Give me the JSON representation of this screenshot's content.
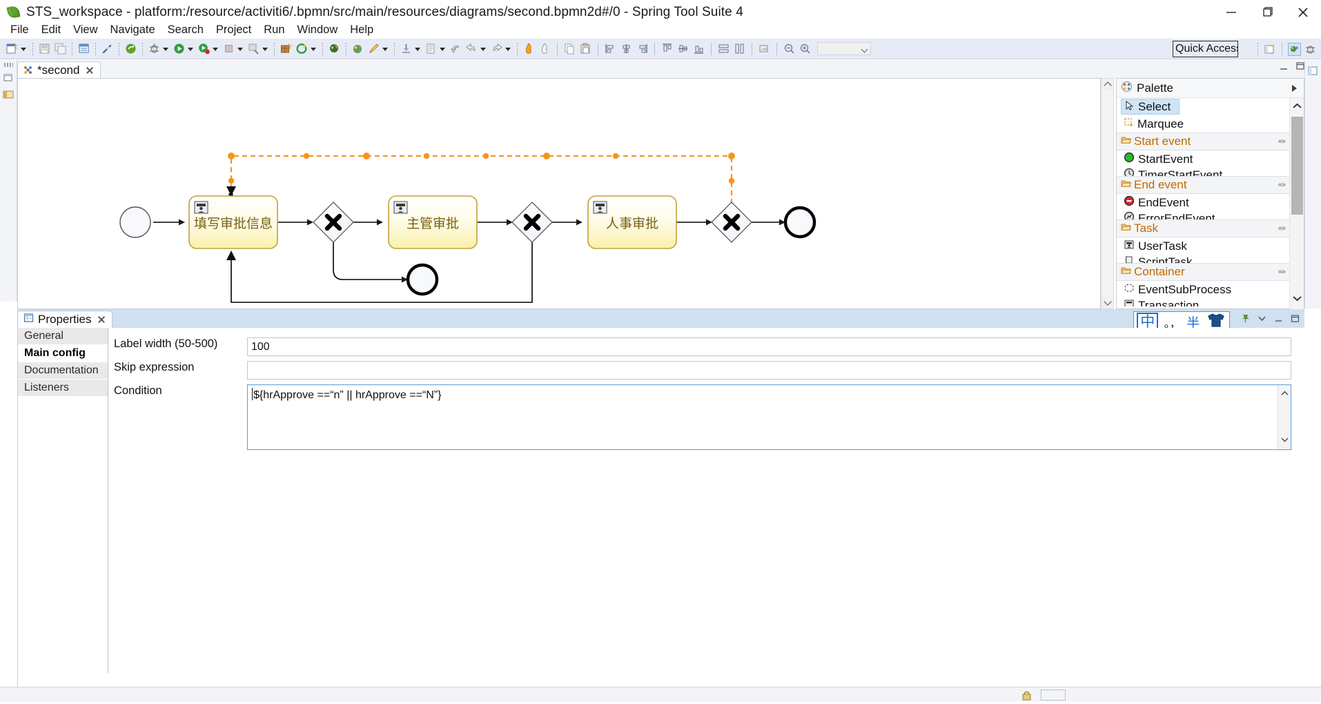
{
  "window": {
    "title": "STS_workspace - platform:/resource/activiti6/.bpmn/src/main/resources/diagrams/second.bpmn2d#/0 - Spring Tool Suite 4",
    "app_icon": "spring-leaf-icon",
    "minimize_label": "Minimize",
    "maximize_label": "Restore",
    "close_label": "Close"
  },
  "menubar": {
    "items": [
      {
        "label": "File"
      },
      {
        "label": "Edit"
      },
      {
        "label": "View"
      },
      {
        "label": "Navigate"
      },
      {
        "label": "Search"
      },
      {
        "label": "Project"
      },
      {
        "label": "Run"
      },
      {
        "label": "Window"
      },
      {
        "label": "Help"
      }
    ]
  },
  "toolbar": {
    "quick_access_label": "Quick Access",
    "zoom_combo_value": "",
    "icons": [
      "new-wizard-icon",
      "dropdown-arrow-icon",
      "save-icon",
      "save-all-icon",
      "new-file-icon",
      "link-break-icon",
      "spring-boot-icon",
      "debug-icon",
      "dropdown-arrow-icon",
      "run-icon",
      "dropdown-arrow-icon",
      "run-boot-icon",
      "dropdown-arrow-icon",
      "terminate-icon",
      "dropdown-arrow-icon",
      "external-tools-icon",
      "dropdown-arrow-icon",
      "new-package-icon",
      "refresh-icon",
      "dropdown-arrow-icon",
      "open-type-icon",
      "pencil-icon",
      "dropdown-arrow-icon",
      "download-icon",
      "dropdown-arrow-icon",
      "annotate-icon",
      "dropdown-arrow-icon",
      "back-step-icon",
      "undo-icon",
      "dropdown-arrow-icon",
      "redo-icon",
      "dropdown-arrow-icon",
      "fire-icon",
      "ghost-icon",
      "copy-icon",
      "paste-icon",
      "align-left-icon",
      "align-center-icon",
      "align-right-icon",
      "align-top-icon",
      "align-middle-icon",
      "align-bottom-icon",
      "match-width-icon",
      "match-height-icon",
      "export-image-icon",
      "zoom-out-icon",
      "zoom-in-icon"
    ],
    "right_icons": [
      "perspective-open-icon",
      "java-perspective-icon",
      "debug-perspective-icon"
    ]
  },
  "editor": {
    "tab": {
      "label": "*second",
      "icon": "bpmn-diagram-icon",
      "close_icon": "close-icon",
      "dirty": true
    },
    "minimize_label": "Minimize",
    "maximize_label": "Maximize",
    "scroll_up_icon": "chevron-up-icon",
    "scroll_down_icon": "chevron-down-icon"
  },
  "diagram": {
    "type": "bpmn-process",
    "colors": {
      "task_fill_top": "#ffffff",
      "task_fill_bottom": "#fdf6c4",
      "task_border": "#c0a13a",
      "task_text": "#7a6010",
      "flow_stroke": "#000000",
      "selected_flow": "#f7941e",
      "event_fill": "#f7f9fc",
      "event_border": "#565656"
    },
    "nodes": [
      {
        "id": "start",
        "type": "start-event",
        "label": ""
      },
      {
        "id": "task1",
        "type": "user-task",
        "label": "填写审批信息"
      },
      {
        "id": "gw1",
        "type": "exclusive-gateway",
        "label": ""
      },
      {
        "id": "task2",
        "type": "user-task",
        "label": "主管审批"
      },
      {
        "id": "gw2",
        "type": "exclusive-gateway",
        "label": ""
      },
      {
        "id": "task3",
        "type": "user-task",
        "label": "人事审批"
      },
      {
        "id": "gw3",
        "type": "exclusive-gateway",
        "label": ""
      },
      {
        "id": "end1",
        "type": "end-event",
        "label": ""
      },
      {
        "id": "end2",
        "type": "end-event",
        "label": ""
      }
    ],
    "flows": [
      {
        "from": "start",
        "to": "task1",
        "selected": false
      },
      {
        "from": "task1",
        "to": "gw1",
        "selected": false
      },
      {
        "from": "gw1",
        "to": "task2",
        "selected": false
      },
      {
        "from": "gw1",
        "to": "end2",
        "selected": false
      },
      {
        "from": "task2",
        "to": "gw2",
        "selected": false
      },
      {
        "from": "gw2",
        "to": "task3",
        "selected": false
      },
      {
        "from": "gw2",
        "to": "task1",
        "selected": false
      },
      {
        "from": "task3",
        "to": "gw3",
        "selected": false
      },
      {
        "from": "gw3",
        "to": "end1",
        "selected": false
      },
      {
        "from": "gw3",
        "to": "task1",
        "selected": true
      }
    ]
  },
  "palette": {
    "title": "Palette",
    "header_icon": "palette-icon",
    "pin_icon": "play-triangle-icon",
    "tools": [
      {
        "label": "Select",
        "icon": "cursor-icon",
        "selected": true
      },
      {
        "label": "Marquee",
        "icon": "marquee-icon",
        "selected": false
      }
    ],
    "groups": [
      {
        "label": "Start event",
        "collapse_icon": "collapse-icon",
        "items": [
          {
            "label": "StartEvent",
            "icon": "start-event-icon"
          },
          {
            "label": "TimerStartEvent",
            "icon": "timer-start-event-icon"
          }
        ]
      },
      {
        "label": "End event",
        "collapse_icon": "collapse-icon",
        "items": [
          {
            "label": "EndEvent",
            "icon": "end-event-icon"
          },
          {
            "label": "ErrorEndEvent",
            "icon": "error-end-event-icon"
          }
        ]
      },
      {
        "label": "Task",
        "collapse_icon": "collapse-icon",
        "items": [
          {
            "label": "UserTask",
            "icon": "user-task-icon"
          },
          {
            "label": "ScriptTask",
            "icon": "script-task-icon"
          }
        ]
      },
      {
        "label": "Container",
        "collapse_icon": "collapse-icon",
        "items": [
          {
            "label": "EventSubProcess",
            "icon": "event-subprocess-icon"
          },
          {
            "label": "Transaction",
            "icon": "transaction-icon"
          }
        ]
      }
    ]
  },
  "properties": {
    "view_title": "Properties",
    "view_icon": "properties-icon",
    "close_icon": "close-icon",
    "ime_indicator": {
      "mode": "中",
      "punctuation": "。，",
      "width_mode": "半",
      "extra_icon": "shirt-icon"
    },
    "tabs": [
      {
        "label": "General",
        "active": false
      },
      {
        "label": "Main config",
        "active": true
      },
      {
        "label": "Documentation",
        "active": false
      },
      {
        "label": "Listeners",
        "active": false
      }
    ],
    "fields": [
      {
        "name": "label-width",
        "label": "Label width (50-500)",
        "value": "100",
        "type": "text"
      },
      {
        "name": "skip-expression",
        "label": "Skip expression",
        "value": "",
        "type": "text"
      },
      {
        "name": "condition",
        "label": "Condition",
        "value": "${hrApprove ==“n” || hrApprove ==“N”}",
        "type": "textarea",
        "focused": true
      }
    ]
  },
  "statusbar": {
    "lock_icon": "lock-icon",
    "text": ""
  }
}
